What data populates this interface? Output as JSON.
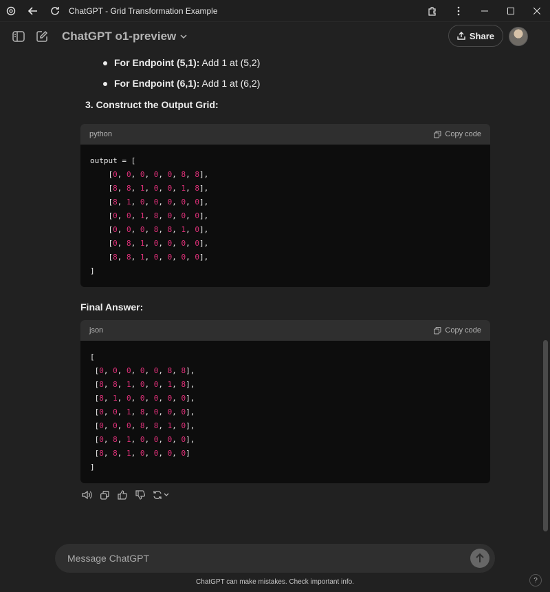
{
  "window": {
    "title": "ChatGPT - Grid Transformation Example"
  },
  "header": {
    "model_name": "ChatGPT o1-preview",
    "share_label": "Share"
  },
  "content": {
    "bullets": [
      {
        "label": "For Endpoint (5,1):",
        "text": " Add 1 at (5,2)"
      },
      {
        "label": "For Endpoint (6,1):",
        "text": " Add 1 at (6,2)"
      }
    ],
    "step": "3.  Construct the Output Grid:",
    "code_blocks": [
      {
        "lang": "python",
        "copy_label": "Copy code",
        "open": "output = [",
        "close": "]",
        "rows": [
          [
            0,
            0,
            0,
            0,
            0,
            8,
            8
          ],
          [
            8,
            8,
            1,
            0,
            0,
            1,
            8
          ],
          [
            8,
            1,
            0,
            0,
            0,
            0,
            0
          ],
          [
            0,
            0,
            1,
            8,
            0,
            0,
            0
          ],
          [
            0,
            0,
            0,
            8,
            8,
            1,
            0
          ],
          [
            0,
            8,
            1,
            0,
            0,
            0,
            0
          ],
          [
            8,
            8,
            1,
            0,
            0,
            0,
            0
          ]
        ]
      },
      {
        "lang": "json",
        "copy_label": "Copy code",
        "open": "[",
        "close": "]",
        "rows": [
          [
            0,
            0,
            0,
            0,
            0,
            8,
            8
          ],
          [
            8,
            8,
            1,
            0,
            0,
            1,
            8
          ],
          [
            8,
            1,
            0,
            0,
            0,
            0,
            0
          ],
          [
            0,
            0,
            1,
            8,
            0,
            0,
            0
          ],
          [
            0,
            0,
            0,
            8,
            8,
            1,
            0
          ],
          [
            0,
            8,
            1,
            0,
            0,
            0,
            0
          ],
          [
            8,
            8,
            1,
            0,
            0,
            0,
            0
          ]
        ]
      }
    ],
    "final_answer": "Final Answer:"
  },
  "composer": {
    "placeholder": "Message ChatGPT"
  },
  "footer": {
    "disclaimer": "ChatGPT can make mistakes. Check important info.",
    "help": "?"
  },
  "colors": {
    "number": "#df3079",
    "background": "#212121"
  }
}
